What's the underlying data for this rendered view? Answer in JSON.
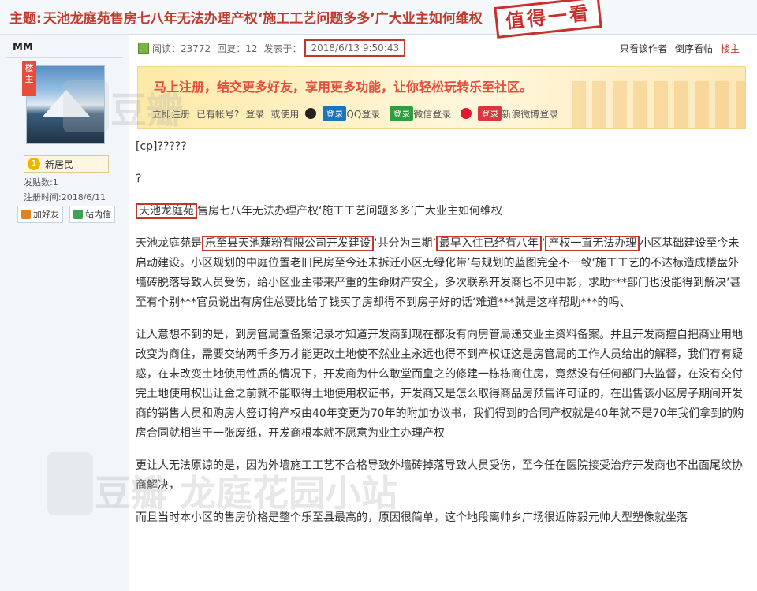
{
  "thread": {
    "topic_label": "主题:",
    "title": "天池龙庭苑售房七八年无法办理产权‘施工工艺问题多多’广大业主如何维权",
    "stamp_text": "值得一看"
  },
  "author": {
    "name": "MM",
    "role_ribbon": "楼主",
    "rank": "新居民",
    "posts": "发贴数:1",
    "registered": "注册时间:2018/6/11",
    "add_friend": "加好友",
    "message": "站内信"
  },
  "meta": {
    "views": "阅读：23772",
    "replies": "回复：12",
    "posted_label": "发表于：",
    "posted_date": "2018/6/13 9:50:43",
    "only_author": "只看该作者",
    "reverse": "倒序看帖",
    "floor": "楼主"
  },
  "banner": {
    "title": "马上注册，结交更多好友，享用更多功能，让你轻松玩转乐至社区。",
    "register": "立即注册",
    "has_account": "已有帐号?",
    "login": "登录",
    "or_use": "或使用",
    "login_badge": "登录",
    "qq": "QQ登录",
    "wechat": "微信登录",
    "weibo": "新浪微博登录"
  },
  "post": {
    "line1": "[cp]?????",
    "line2": "?",
    "title_hl": "天池龙庭苑",
    "title_rest": "售房七八年无法办理产权‘施工工艺问题多多’广大业主如何维权",
    "p1_a": "天池龙庭苑是",
    "p1_hl1": "乐至县天池藕粉有限公司开发建设",
    "p1_b": "‘共分为三期’",
    "p1_hl2": "最早入住已经有八年",
    "p1_c": "‘",
    "p1_hl3": "产权一直无法办理",
    "p1_d": "小区基础建设至今未启动建设。小区规划的中庭位置老旧民房至今还未拆迁小区无绿化带’与规划的蓝图完全不一致‘施工工艺的不达标造成楼盘外墙砖脱落导致人员受伤，给小区业主带来严重的生命财产安全，多次联系开发商也不见中影，求助***部门也没能得到解决’甚至有个别***官员说出有房住总要比给了钱买了房却得不到房子好的话‘难道***就是这样帮助***的吗、",
    "p2": "让人意想不到的是，到房管局查备案记录才知道开发商到现在都没有向房管局递交业主资料备案。并且开发商擅自把商业用地改变为商住，需要交纳两千多万才能更改土地使不然业主永远也得不到产权证这是房管局的工作人员给出的解释，我们存有疑惑，在未改变土地使用性质的情况下，开发商为什么敢堂而皇之的修建一栋栋商住房，竟然没有任何部门去监督，在没有交付完土地使用权出让金之前就不能取得土地使用权证书，开发商又是怎么取得商品房预售许可证的，在出售该小区房子期间开发商的销售人员和购房人签订将产权由40年变更为70年的附加协议书，我们得到的合同产权就是40年就不是70年我们拿到的购房合同就相当于一张废纸，开发商根本就不愿意为业主办理产权",
    "p3": "更让人无法原谅的是，因为外墙施工工艺不合格导致外墙砖掉落导致人员受伤，至今任在医院接受治疗开发商也不出面尾纹协商解决，",
    "p4": "而且当时本小区的售房价格是整个乐至县最高的，原因很简单，这个地段离帅乡广场很近陈毅元帅大型塑像就坐落"
  },
  "watermark": {
    "text1": "豆瓣",
    "text2": "豆瓣 龙庭花园小站"
  },
  "colors": {
    "accent": "#c0392b",
    "banner_bg": "#fde9a7",
    "sidebar_bg": "#f2f6fa"
  }
}
